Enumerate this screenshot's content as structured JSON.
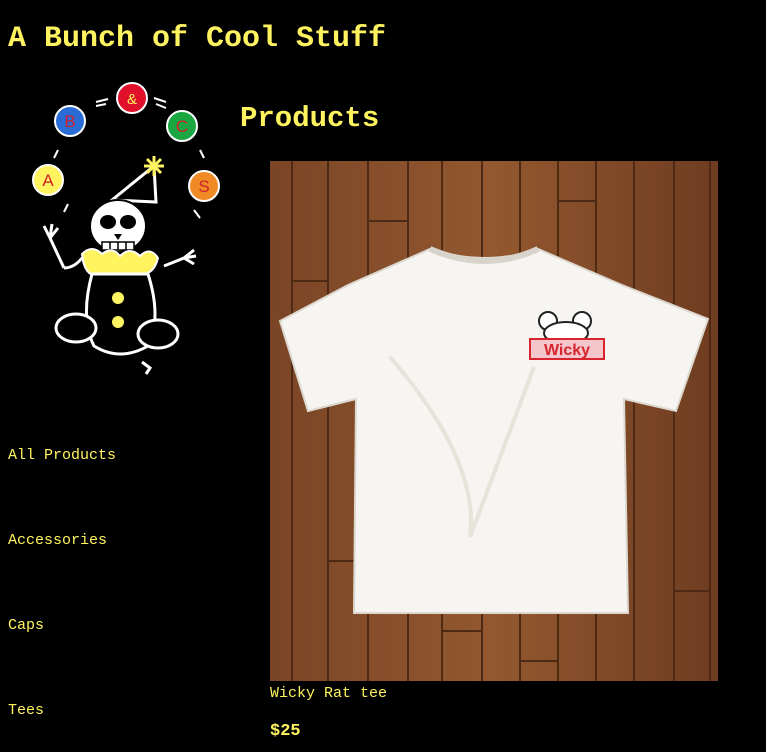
{
  "site": {
    "title": "A Bunch of Cool Stuff"
  },
  "logo": {
    "letters": [
      "A",
      "B",
      "&",
      "C",
      "S"
    ]
  },
  "nav": {
    "items": [
      {
        "label": "All Products"
      },
      {
        "label": "Accessories"
      },
      {
        "label": "Caps"
      },
      {
        "label": "Tees"
      }
    ]
  },
  "main": {
    "title": "Products",
    "products": [
      {
        "name": "Wicky Rat tee",
        "price": "$25",
        "graphic_text": "Wicky"
      }
    ]
  },
  "colors": {
    "accent": "#fff45f",
    "background": "#000000"
  }
}
